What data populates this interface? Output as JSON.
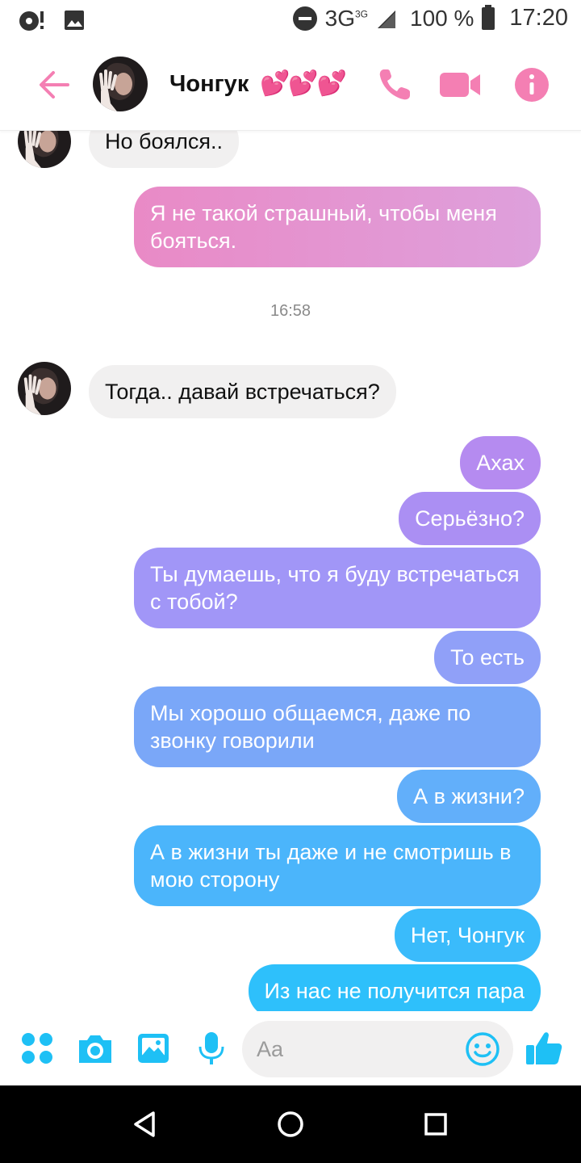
{
  "status_bar": {
    "network": "3G",
    "network_super": "3G",
    "battery": "100 %",
    "time": "17:20",
    "icons": [
      "media-playback-icon",
      "image-notification-icon",
      "do-not-disturb-icon",
      "signal-icon",
      "battery-icon"
    ]
  },
  "header": {
    "contact_name": "Чонгук",
    "contact_hearts": "💕💕💕",
    "icons": [
      "back-arrow-icon",
      "phone-icon",
      "video-camera-icon",
      "info-icon"
    ]
  },
  "messages": [
    {
      "side": "in",
      "text": "Но боялся.."
    },
    {
      "side": "out",
      "text": "Я не такой страшный, чтобы меня бояться.",
      "color": "#e28ccc"
    },
    {
      "timestamp": "16:58"
    },
    {
      "side": "in",
      "text": "Тогда.. давай встречаться?"
    },
    {
      "side": "out",
      "text": "Ахах",
      "color": "#b58bf0"
    },
    {
      "side": "out",
      "text": "Серьёзно?",
      "color": "#ad8df2"
    },
    {
      "side": "out",
      "text": "Ты думаешь, что я буду встречаться с тобой?",
      "color": "#9e98f8"
    },
    {
      "side": "out",
      "text": "То есть",
      "color": "#8ea0f8"
    },
    {
      "side": "out",
      "text": "Мы хорошо общаемся, даже по звонку говорили",
      "color": "#78a8f8"
    },
    {
      "side": "out",
      "text": "А в жизни?",
      "color": "#5fb0fa"
    },
    {
      "side": "out",
      "text": "А в жизни ты даже и не смотришь в мою сторону",
      "color": "#48b6fb"
    },
    {
      "side": "out",
      "text": "Нет, Чонгук",
      "color": "#37bcfb"
    },
    {
      "side": "out",
      "text": "Из нас не получится пара",
      "color": "#2bc0fb"
    }
  ],
  "composer": {
    "placeholder": "Aa",
    "accent": "#1ec0f5",
    "icons": [
      "apps-icon",
      "camera-icon",
      "gallery-icon",
      "microphone-icon",
      "emoji-icon",
      "thumbs-up-icon"
    ]
  },
  "navbar": {
    "icons": [
      "nav-back-icon",
      "nav-home-icon",
      "nav-recent-icon"
    ]
  },
  "colors": {
    "header_accent": "#f47fb3",
    "incoming_bubble": "#f1f0f0",
    "navbar": "#000000"
  }
}
